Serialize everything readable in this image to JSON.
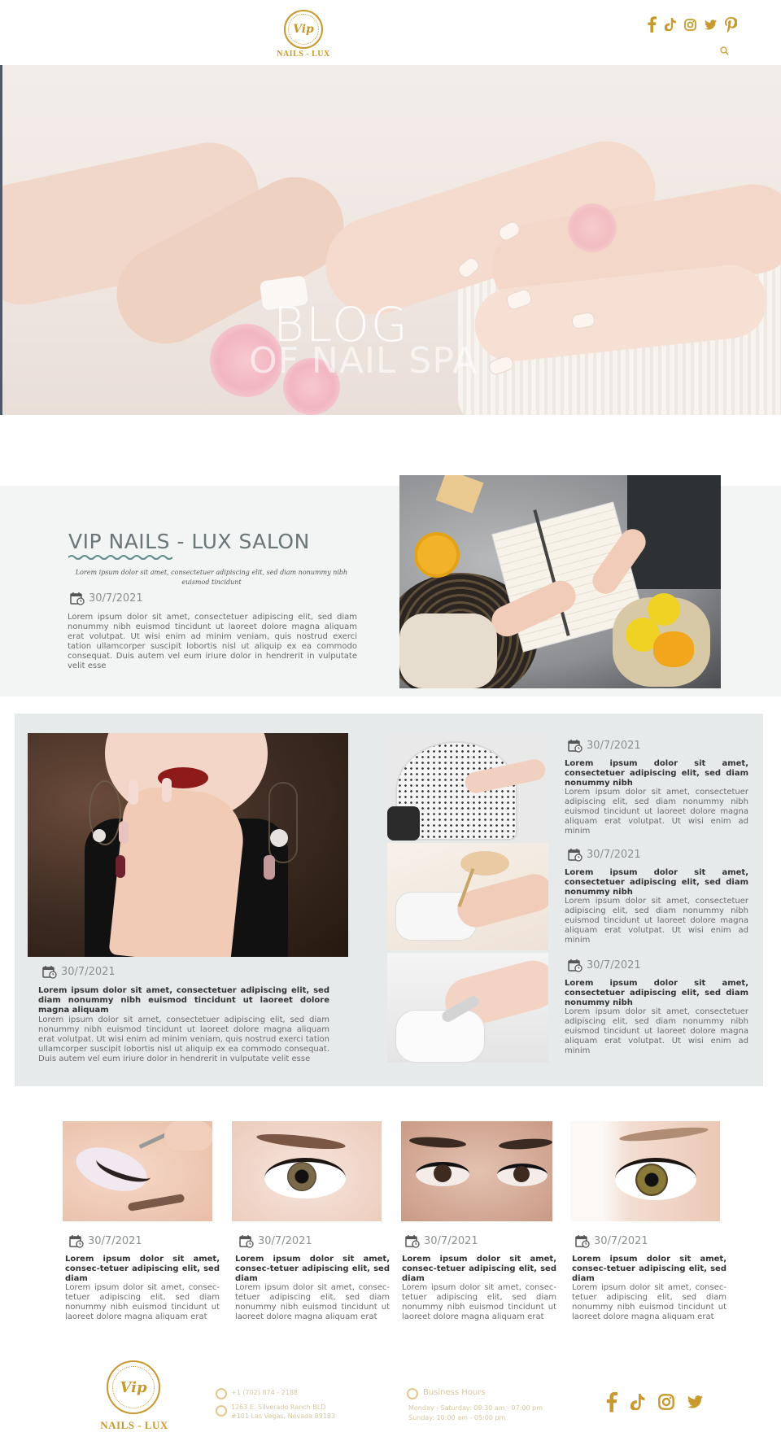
{
  "header": {
    "logo_monogram": "Vip",
    "logo_text": "NAILS - LUX",
    "social_icons": [
      "facebook-icon",
      "tiktok-icon",
      "instagram-icon",
      "twitter-icon",
      "pinterest-icon"
    ],
    "search_icon": "search-icon"
  },
  "colors": {
    "gold": "#c8992f",
    "band_bg": "#f3f4f4",
    "card_bg": "#e7eaeb",
    "heading": "#6b7678",
    "wave": "#5d8a86"
  },
  "hero": {
    "title": "BLOG",
    "subtitle": "OF NAIL SPA"
  },
  "featured": {
    "title": "VIP NAILS - LUX SALON",
    "tagline": "Lorem ipsum dolor sit amet, consectetuer adipiscing elit, sed diam nonummy nibh euismod tincidunt",
    "date": "30/7/2021",
    "body": "Lorem ipsum dolor sit amet, consectetuer adipiscing elit, sed diam nonummy nibh euismod tincidunt ut laoreet dolore magna aliquam erat volutpat. Ut wisi enim ad minim veniam, quis nostrud exerci tation ullamcorper suscipit lobortis nisl ut aliquip ex ea commodo consequat. Duis autem vel eum iriure dolor in hendrerit in vulputate velit esse"
  },
  "main_post": {
    "date": "30/7/2021",
    "lead": "Lorem ipsum dolor sit amet, consectetuer adipiscing elit, sed diam nonummy nibh euismod tincidunt ut laoreet dolore magna aliquam",
    "body": "Lorem ipsum dolor sit amet, consectetuer adipiscing elit, sed diam nonummy nibh euismod tincidunt ut laoreet dolore magna aliquam erat volutpat. Ut wisi enim ad minim veniam, quis nostrud exerci tation ullamcorper suscipit lobortis nisl ut aliquip ex ea commodo consequat. Duis autem vel eum iriure dolor in hendrerit in vulputate velit esse"
  },
  "side_posts": [
    {
      "date": "30/7/2021",
      "lead": "Lorem ipsum dolor sit amet, consectetuer adipiscing elit, sed diam nonummy nibh",
      "body": "Lorem ipsum dolor sit amet, consectetuer adipiscing elit, sed diam nonummy nibh euismod tincidunt ut laoreet dolore magna aliquam erat volutpat. Ut wisi enim ad minim"
    },
    {
      "date": "30/7/2021",
      "lead": "Lorem ipsum dolor sit amet, consectetuer adipiscing elit, sed diam nonummy nibh",
      "body": "Lorem ipsum dolor sit amet, consectetuer adipiscing elit, sed diam nonummy nibh euismod tincidunt ut laoreet dolore magna aliquam erat volutpat. Ut wisi enim ad minim"
    },
    {
      "date": "30/7/2021",
      "lead": "Lorem ipsum dolor sit amet, consectetuer adipiscing elit, sed diam nonummy nibh",
      "body": "Lorem ipsum dolor sit amet, consectetuer adipiscing elit, sed diam nonummy nibh euismod tincidunt ut laoreet dolore magna aliquam erat volutpat. Ut wisi enim ad minim"
    }
  ],
  "lash_posts": [
    {
      "date": "30/7/2021",
      "lead": "Lorem ipsum dolor sit amet, consec-tetuer adipiscing elit, sed diam",
      "body": "Lorem ipsum dolor sit amet, consec-tetuer adipiscing elit, sed diam nonummy nibh euismod tincidunt ut laoreet dolore magna aliquam erat"
    },
    {
      "date": "30/7/2021",
      "lead": "Lorem ipsum dolor sit amet, consec-tetuer adipiscing elit, sed diam",
      "body": "Lorem ipsum dolor sit amet, consec-tetuer adipiscing elit, sed diam nonummy nibh euismod tincidunt ut laoreet dolore magna aliquam erat"
    },
    {
      "date": "30/7/2021",
      "lead": "Lorem ipsum dolor sit amet, consec-tetuer adipiscing elit, sed diam",
      "body": "Lorem ipsum dolor sit amet, consec-tetuer adipiscing elit, sed diam nonummy nibh euismod tincidunt ut laoreet dolore magna aliquam erat"
    },
    {
      "date": "30/7/2021",
      "lead": "Lorem ipsum dolor sit amet, consec-tetuer adipiscing elit, sed diam",
      "body": "Lorem ipsum dolor sit amet, consec-tetuer adipiscing elit, sed diam nonummy nibh euismod tincidunt ut laoreet dolore magna aliquam erat"
    }
  ],
  "footer": {
    "logo_monogram": "Vip",
    "logo_text": "NAILS - LUX",
    "phone": "+1 (702) 874 - 2188",
    "address_line1": "1263 E. Silverado Ranch BLD",
    "address_line2": "#101 Las Vegas, Nevada 89183",
    "hours_title": "Business Hours",
    "hours_line1": "Monday - Saturday: 09:30 am - 07:00 pm",
    "hours_line2": "Sunday: 10:00 am - 05:00 pm",
    "social_icons": [
      "facebook-icon",
      "tiktok-icon",
      "instagram-icon",
      "twitter-icon"
    ]
  }
}
